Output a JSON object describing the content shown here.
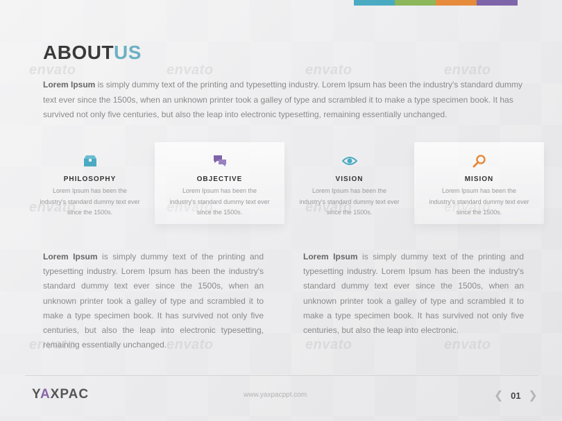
{
  "colors": {
    "accent_blue": "#4aaac2",
    "accent_green": "#8cb75a",
    "accent_orange": "#e68a3c",
    "accent_purple": "#7e64a8",
    "title_light": "#6cb0c4"
  },
  "color_bar": [
    "#4aaac2",
    "#8cb75a",
    "#e68a3c",
    "#7e64a8"
  ],
  "title": {
    "part1": "ABOUT",
    "part2": "US"
  },
  "intro": {
    "lead": "Lorem Ipsum",
    "text": " is simply dummy text of the printing and typesetting industry. Lorem Ipsum has been the industry's standard dummy text ever since the 1500s, when an unknown printer took a galley of type and scrambled it to make a type specimen book.  It has survived not only five centuries, but also the leap into electronic typesetting, remaining essentially unchanged."
  },
  "features": [
    {
      "icon": "box-icon",
      "title": "PHILOSOPHY",
      "text": "Lorem Ipsum has been the industry's standard dummy text ever since the 1500s."
    },
    {
      "icon": "chat-icon",
      "title": "OBJECTIVE",
      "text": "Lorem Ipsum has been the industry's standard dummy text ever since the 1500s."
    },
    {
      "icon": "eye-icon",
      "title": "VISION",
      "text": "Lorem Ipsum has been the industry's standard dummy text ever since the 1500s."
    },
    {
      "icon": "magnifier-icon",
      "title": "MISION",
      "text": "Lorem Ipsum has been the industry's standard dummy text ever since the 1500s."
    }
  ],
  "left_column": {
    "lead": "Lorem Ipsum",
    "text": " is simply dummy text of the printing and typesetting industry. Lorem Ipsum has been the industry's standard dummy text ever since the 1500s, when an unknown printer took a galley of type and scrambled it to make a type specimen book.  It has survived not only five centuries, but also the leap into electronic typesetting, remaining essentially unchanged."
  },
  "right_column": {
    "lead": "Lorem Ipsum",
    "text": " is simply dummy text of the printing and typesetting industry. Lorem Ipsum has been the industry's standard dummy text ever since the 1500s, when an unknown printer took a galley of type and scrambled it to make a type specimen book.  It has survived not only five centuries, but also the leap into electronic."
  },
  "watermark_text": "envato",
  "footer": {
    "brand_1": "Y",
    "brand_a": "A",
    "brand_2": "XPAC",
    "url": "www.yaxpacppt.com",
    "page": "01",
    "prev_glyph": "❮",
    "next_glyph": "❯"
  }
}
